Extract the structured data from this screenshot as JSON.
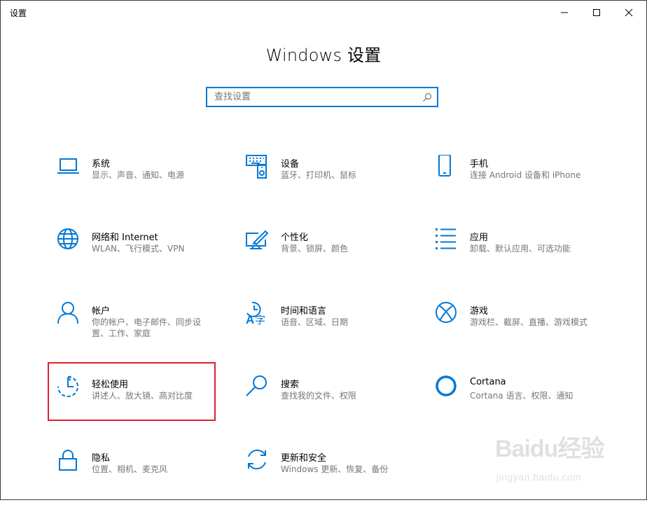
{
  "window": {
    "title": "设置"
  },
  "heading": "Windows 设置",
  "search": {
    "placeholder": "查找设置",
    "value": ""
  },
  "tiles": [
    {
      "name": "系统",
      "desc": "显示、声音、通知、电源",
      "icon": "laptop-icon"
    },
    {
      "name": "设备",
      "desc": "蓝牙、打印机、鼠标",
      "icon": "devices-icon"
    },
    {
      "name": "手机",
      "desc": "连接 Android 设备和 iPhone",
      "icon": "phone-icon"
    },
    {
      "name": "网络和 Internet",
      "desc": "WLAN、飞行模式、VPN",
      "icon": "globe-icon"
    },
    {
      "name": "个性化",
      "desc": "背景、锁屏、颜色",
      "icon": "personalization-icon"
    },
    {
      "name": "应用",
      "desc": "卸载、默认应用、可选功能",
      "icon": "apps-list-icon"
    },
    {
      "name": "帐户",
      "desc": "你的帐户、电子邮件、同步设置、工作、家庭",
      "icon": "person-icon"
    },
    {
      "name": "时间和语言",
      "desc": "语音、区域、日期",
      "icon": "time-language-icon"
    },
    {
      "name": "游戏",
      "desc": "游戏栏、截屏、直播、游戏模式",
      "icon": "xbox-icon"
    },
    {
      "name": "轻松使用",
      "desc": "讲述人、放大镜、高对比度",
      "icon": "ease-of-access-icon"
    },
    {
      "name": "搜索",
      "desc": "查找我的文件、权限",
      "icon": "search-icon"
    },
    {
      "name": "Cortana",
      "desc": "Cortana 语言、权限、通知",
      "icon": "cortana-icon"
    },
    {
      "name": "隐私",
      "desc": "位置、相机、麦克风",
      "icon": "lock-icon"
    },
    {
      "name": "更新和安全",
      "desc": "Windows 更新、恢复、备份",
      "icon": "update-icon"
    }
  ],
  "highlighted_tile": "轻松使用",
  "colors": {
    "accent": "#0078d7",
    "highlight": "#e0202b",
    "secondary_text": "#767676"
  },
  "watermark": {
    "logo": "Baidu经验",
    "url": "jingyan.baidu.com"
  }
}
